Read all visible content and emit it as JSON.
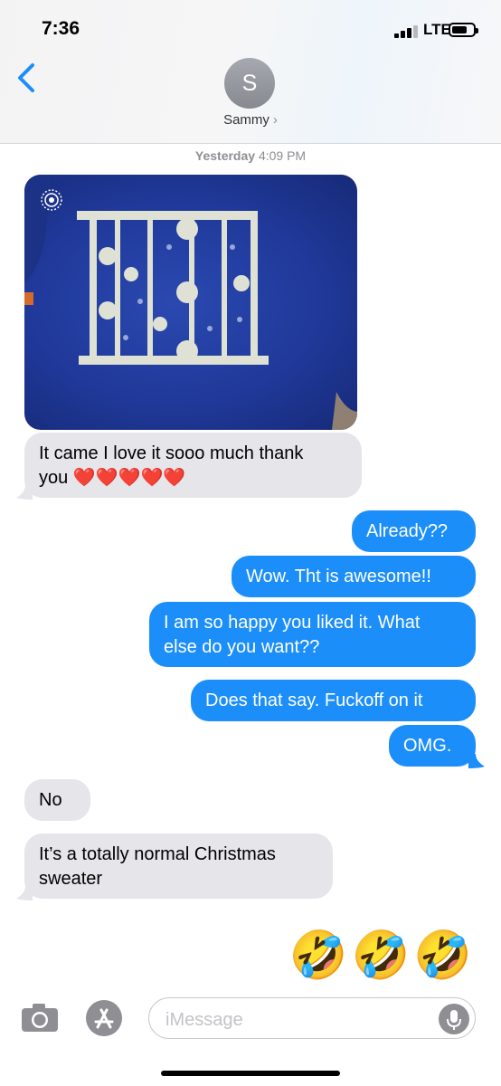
{
  "status_bar": {
    "time": "7:36",
    "network": "LTE"
  },
  "header": {
    "avatar_initial": "S",
    "contact_name": "Sammy",
    "contact_chevron": "›"
  },
  "timestamp": {
    "day": "Yesterday",
    "time": "4:09 PM"
  },
  "photo": {
    "description_icon": "live-photo-icon"
  },
  "messages": [
    {
      "from": "them",
      "line1": "It came I love it sooo much thank",
      "line2": "you ❤️❤️❤️❤️❤️"
    },
    {
      "from": "me",
      "text": "Already??"
    },
    {
      "from": "me",
      "text": "Wow. Tht is awesome!!"
    },
    {
      "from": "me",
      "line1": "I am so happy you liked it. What",
      "line2": "else do you want??"
    },
    {
      "from": "me",
      "text": "Does that say. Fuckoff on it"
    },
    {
      "from": "me",
      "text": "OMG."
    },
    {
      "from": "them",
      "text": "No"
    },
    {
      "from": "them",
      "line1": "It’s a totally normal Christmas",
      "line2": "sweater"
    },
    {
      "from": "me",
      "emoji": "🤣🤣🤣"
    }
  ],
  "composer": {
    "placeholder": "iMessage"
  },
  "colors": {
    "outgoing": "#1c8ef9",
    "incoming": "#e5e5ea",
    "accent": "#1c8ef9"
  }
}
